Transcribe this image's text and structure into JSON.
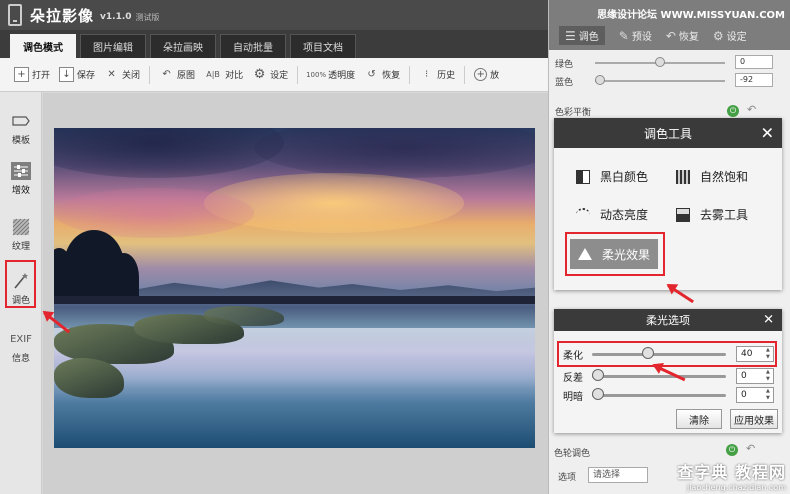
{
  "app": {
    "title": "朵拉影像",
    "version": "v1.1.0",
    "edition": "测试版"
  },
  "tabs": [
    {
      "label": "调色模式",
      "active": true
    },
    {
      "label": "图片编辑",
      "active": false
    },
    {
      "label": "朵拉画映",
      "active": false
    },
    {
      "label": "自动批量",
      "active": false
    },
    {
      "label": "项目文档",
      "active": false
    }
  ],
  "toolbar": {
    "open": "打开",
    "save": "保存",
    "close": "关闭",
    "original": "原图",
    "compare": "对比",
    "settings": "设定",
    "opacity": "透明度",
    "restore": "恢复",
    "history": "历史",
    "zoom": "放"
  },
  "sidebar": {
    "template": "模板",
    "enhance": "增效",
    "texture": "纹理",
    "color": "调色",
    "exif_title": "EXIF",
    "exif_info": "信息"
  },
  "right_panel": {
    "watermark": "思缘设计论坛 WWW.MISSYUAN.COM",
    "top_tabs": [
      "调色",
      "预设",
      "恢复",
      "设定"
    ],
    "green_label": "绿色",
    "green_value": "0",
    "blue_label": "蓝色",
    "blue_value": "-92",
    "color_balance": "色彩平衡",
    "color_wheel": "色轮调色",
    "select_label": "选项",
    "select_placeholder": "请选择"
  },
  "tools_dialog": {
    "title": "调色工具",
    "tools": [
      "黑白颜色",
      "自然饱和",
      "动态亮度",
      "去雾工具",
      "柔光效果"
    ],
    "active_tool": "柔光效果"
  },
  "soft_dialog": {
    "title": "柔光选项",
    "options": [
      {
        "label": "柔化",
        "value": "40",
        "level": 0.4
      },
      {
        "label": "反差",
        "value": "0",
        "level": 0
      },
      {
        "label": "明暗",
        "value": "0",
        "level": 0
      }
    ],
    "clear_button": "清除",
    "apply_button": "应用效果"
  },
  "site_watermark": {
    "name": "查字典 教程网",
    "url": "jiaocheng.chazidian.com"
  },
  "colors": {
    "highlight": "#e3262d",
    "titlebar": "#4a4a4a",
    "dialog_header": "#3a3a3a"
  }
}
